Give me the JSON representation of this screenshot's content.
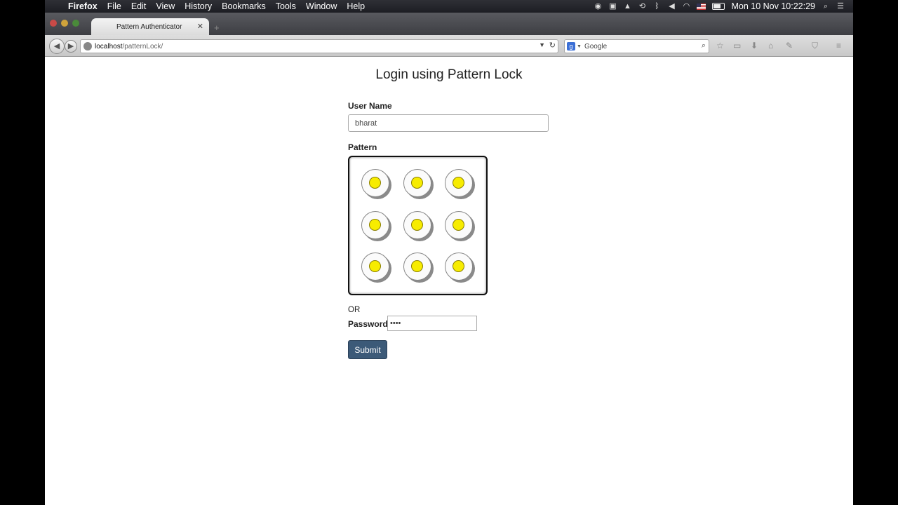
{
  "menubar": {
    "app_name": "Firefox",
    "menus": [
      "File",
      "Edit",
      "View",
      "History",
      "Bookmarks",
      "Tools",
      "Window",
      "Help"
    ],
    "clock": "Mon 10 Nov  10:22:29"
  },
  "browser": {
    "tab_title": "Pattern Authenticator",
    "url_host": "localhost",
    "url_path": "/patternLock/",
    "search_engine": "Google"
  },
  "page": {
    "heading": "Login using Pattern Lock",
    "username_label": "User Name",
    "username_value": "bharat",
    "pattern_label": "Pattern",
    "or_text": "OR",
    "password_label": "Password",
    "password_value": "••••",
    "submit_label": "Submit"
  },
  "pattern": {
    "rows": 3,
    "cols": 3,
    "dot_color": "#f7ec00"
  },
  "colors": {
    "submit_bg": "#3c5a78"
  }
}
